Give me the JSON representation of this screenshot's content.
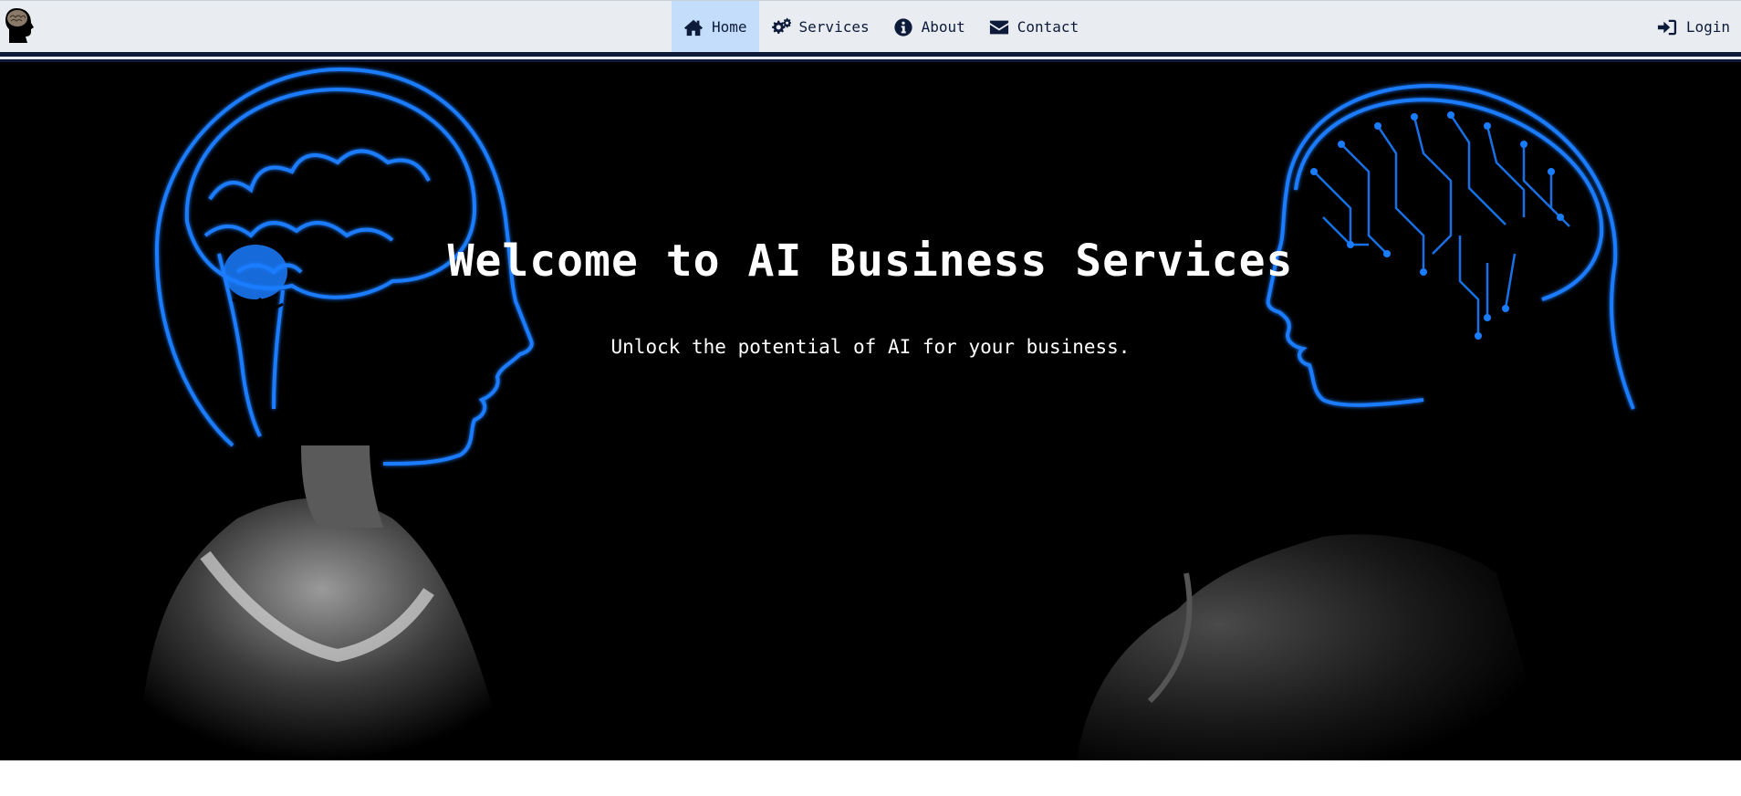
{
  "nav": {
    "logo_icon": "brain-head-icon",
    "items": [
      {
        "label": "Home",
        "icon": "home-icon",
        "active": true
      },
      {
        "label": "Services",
        "icon": "gears-icon",
        "active": false
      },
      {
        "label": "About",
        "icon": "info-circle-icon",
        "active": false
      },
      {
        "label": "Contact",
        "icon": "envelope-icon",
        "active": false
      }
    ],
    "login": {
      "label": "Login",
      "icon": "sign-in-icon"
    }
  },
  "hero": {
    "title": "Welcome to AI Business Services",
    "subtitle": "Unlock the potential of AI for your business."
  },
  "colors": {
    "nav_background": "#e9edf1",
    "nav_text": "#0d1a3a",
    "active_item": "#c3ddfb",
    "hero_background": "#000000",
    "brain_glow": "#1a7cff"
  }
}
